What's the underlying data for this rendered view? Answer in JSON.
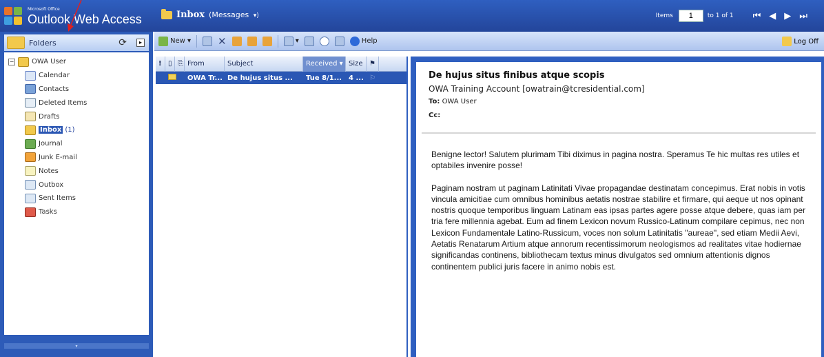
{
  "app": {
    "logo_small": "Microsoft Office",
    "logo_title": "Outlook Web Access"
  },
  "header": {
    "folder_title": "Inbox",
    "view_label": "(Messages",
    "view_arrow": "▾)",
    "items_label": "Items",
    "items_page": "1",
    "items_range": "to 1 of 1",
    "nav": {
      "first": "⏮",
      "prev": "◀",
      "next": "▶",
      "last": "⏭"
    }
  },
  "left": {
    "folders_label": "Folders",
    "root": "OWA User",
    "folders": [
      {
        "label": "Calendar",
        "icon": "calendar-icon"
      },
      {
        "label": "Contacts",
        "icon": "contacts-icon"
      },
      {
        "label": "Deleted Items",
        "icon": "deleted-items-icon"
      },
      {
        "label": "Drafts",
        "icon": "drafts-icon"
      },
      {
        "label": "Inbox",
        "count": "(1)",
        "icon": "inbox-icon"
      },
      {
        "label": "Journal",
        "icon": "journal-icon"
      },
      {
        "label": "Junk E-mail",
        "icon": "junk-email-icon"
      },
      {
        "label": "Notes",
        "icon": "notes-icon"
      },
      {
        "label": "Outbox",
        "icon": "outbox-icon"
      },
      {
        "label": "Sent Items",
        "icon": "sent-items-icon"
      },
      {
        "label": "Tasks",
        "icon": "tasks-icon"
      }
    ]
  },
  "toolbar": {
    "new_label": "New",
    "help_label": "Help",
    "logoff_label": "Log Off"
  },
  "list": {
    "columns": {
      "importance": "!",
      "from": "From",
      "subject": "Subject",
      "received": "Received",
      "size": "Size"
    },
    "rows": [
      {
        "from": "OWA Tr...",
        "subject": "De hujus situs ...",
        "received": "Tue 8/1...",
        "size": "4 ..."
      }
    ]
  },
  "message": {
    "subject": "De hujus situs finibus atque scopis",
    "from": "OWA Training Account [owatrain@tcresidential.com]",
    "to_label": "To:",
    "to": "OWA User",
    "cc_label": "Cc:",
    "body": [
      "Benigne lector! Salutem plurimam Tibi diximus in pagina nostra. Speramus Te hic multas res utiles et optabiles invenire posse!",
      "Paginam nostram ut paginam Latinitati Vivae propagandae destinatam concepimus. Erat nobis in votis vincula amicitiae cum omnibus hominibus aetatis nostrae stabilire et firmare, qui aeque ut nos opinant nostris quoque temporibus linguam Latinam eas ipsas partes agere posse atque debere, quas iam per tria fere millennia agebat. Eum ad finem Lexicon novum Russico-Latinum compilare cepimus, nec non Lexicon Fundamentale Latino-Russicum, voces non solum Latinitatis \"aureae\", sed etiam Medii Aevi, Aetatis Renatarum Artium atque annorum recentissimorum neologismos ad realitates vitae hodiernae significandas continens, bibliothecam textus minus divulgatos sed omnium attentionis dignos continentem publici juris facere in animo nobis est."
    ]
  }
}
